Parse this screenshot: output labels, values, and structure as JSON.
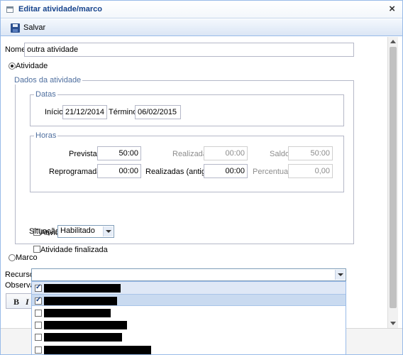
{
  "window": {
    "title": "Editar atividade/marco",
    "close": "×"
  },
  "toolbar": {
    "save_label": "Salvar"
  },
  "form": {
    "nome_label": "Nome",
    "nome_value": "outra atividade",
    "tipo_atividade_label": "Atividade",
    "tipo_marco_label": "Marco",
    "dados_legend": "Dados da atividade",
    "datas_legend": "Datas",
    "inicio_label": "Início",
    "inicio_value": "21/12/2014",
    "termino_label": "Término",
    "termino_value": "06/02/2015",
    "horas_legend": "Horas",
    "previstas_label": "Previstas",
    "previstas_value": "50:00",
    "realizadas_label": "Realizadas",
    "realizadas_value": "00:00",
    "saldo_label": "Saldo",
    "saldo_value": "50:00",
    "reprogramadas_label": "Reprogramadas",
    "reprogramadas_value": "00:00",
    "realizadas_antigo_label": "Realizadas (antigo)",
    "realizadas_antigo_value": "00:00",
    "percentual_label": "Percentual",
    "percentual_value": "0,00",
    "remota_label": "Atividade remota",
    "finalizada_label": "Atividade finalizada",
    "situacao_label": "Situação",
    "situacao_value": "Habilitado",
    "recurso_label": "Recurso",
    "observacao_label": "Observaç"
  },
  "editor": {
    "bold": "B",
    "italic": "I"
  },
  "recurso_options": [
    {
      "checked": true,
      "highlighted": false,
      "redacted_width": 108
    },
    {
      "checked": true,
      "highlighted": true,
      "redacted_width": 103
    },
    {
      "checked": false,
      "highlighted": false,
      "redacted_width": 94
    },
    {
      "checked": false,
      "highlighted": false,
      "redacted_width": 117
    },
    {
      "checked": false,
      "highlighted": false,
      "redacted_width": 110
    },
    {
      "checked": false,
      "highlighted": false,
      "redacted_width": 151
    }
  ]
}
